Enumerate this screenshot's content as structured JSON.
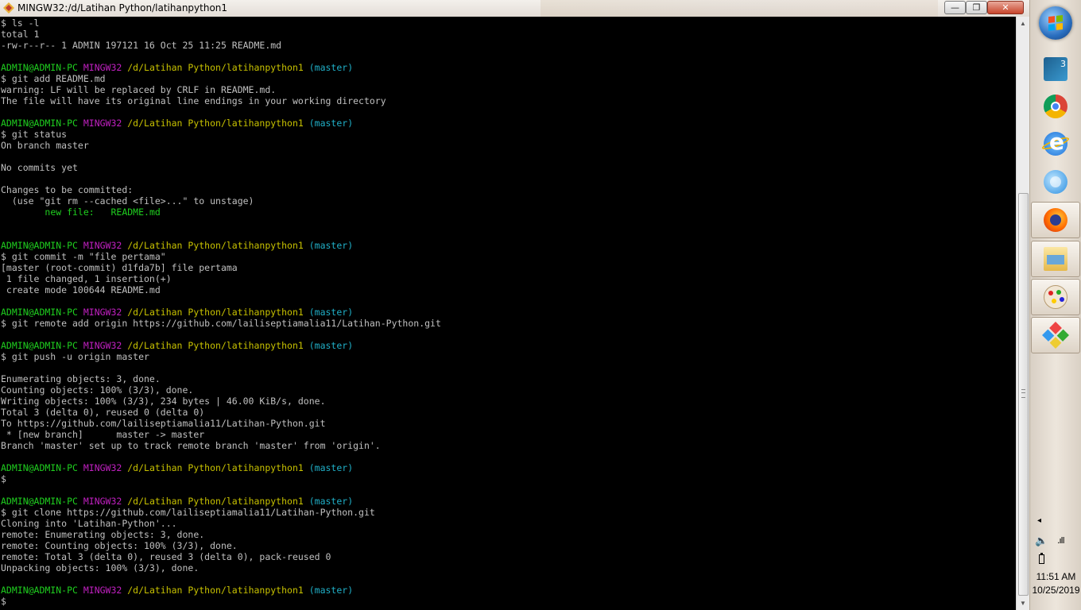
{
  "window": {
    "title": "MINGW32:/d/Latihan Python/latihanpython1",
    "minimize_label": "—",
    "maximize_label": "❐",
    "close_label": "✕"
  },
  "terminal": {
    "colors": {
      "text": "#c0c0c0",
      "user": "#1fcf1f",
      "mingw": "#c020c0",
      "path": "#c8c200",
      "branch": "#20b0c8"
    },
    "lines": [
      {
        "segs": [
          {
            "c": "",
            "t": "$ ls -l"
          }
        ]
      },
      {
        "segs": [
          {
            "c": "",
            "t": "total 1"
          }
        ]
      },
      {
        "segs": [
          {
            "c": "",
            "t": "-rw-r--r-- 1 ADMIN 197121 16 Oct 25 11:25 README.md"
          }
        ]
      },
      {
        "segs": [
          {
            "c": "",
            "t": ""
          }
        ]
      },
      {
        "segs": [
          {
            "c": "user",
            "t": "ADMIN@ADMIN-PC "
          },
          {
            "c": "mingw",
            "t": "MINGW32 "
          },
          {
            "c": "path",
            "t": "/d/Latihan Python/latihanpython1 "
          },
          {
            "c": "branch",
            "t": "(master)"
          }
        ]
      },
      {
        "segs": [
          {
            "c": "",
            "t": "$ git add README.md"
          }
        ]
      },
      {
        "segs": [
          {
            "c": "",
            "t": "warning: LF will be replaced by CRLF in README.md."
          }
        ]
      },
      {
        "segs": [
          {
            "c": "",
            "t": "The file will have its original line endings in your working directory"
          }
        ]
      },
      {
        "segs": [
          {
            "c": "",
            "t": ""
          }
        ]
      },
      {
        "segs": [
          {
            "c": "user",
            "t": "ADMIN@ADMIN-PC "
          },
          {
            "c": "mingw",
            "t": "MINGW32 "
          },
          {
            "c": "path",
            "t": "/d/Latihan Python/latihanpython1 "
          },
          {
            "c": "branch",
            "t": "(master)"
          }
        ]
      },
      {
        "segs": [
          {
            "c": "",
            "t": "$ git status"
          }
        ]
      },
      {
        "segs": [
          {
            "c": "",
            "t": "On branch master"
          }
        ]
      },
      {
        "segs": [
          {
            "c": "",
            "t": ""
          }
        ]
      },
      {
        "segs": [
          {
            "c": "",
            "t": "No commits yet"
          }
        ]
      },
      {
        "segs": [
          {
            "c": "",
            "t": ""
          }
        ]
      },
      {
        "segs": [
          {
            "c": "",
            "t": "Changes to be committed:"
          }
        ]
      },
      {
        "segs": [
          {
            "c": "",
            "t": "  (use \"git rm --cached <file>...\" to unstage)"
          }
        ]
      },
      {
        "segs": [
          {
            "c": "",
            "t": "        "
          },
          {
            "c": "green",
            "t": "new file:   README.md"
          }
        ]
      },
      {
        "segs": [
          {
            "c": "",
            "t": ""
          }
        ]
      },
      {
        "segs": [
          {
            "c": "",
            "t": ""
          }
        ]
      },
      {
        "segs": [
          {
            "c": "user",
            "t": "ADMIN@ADMIN-PC "
          },
          {
            "c": "mingw",
            "t": "MINGW32 "
          },
          {
            "c": "path",
            "t": "/d/Latihan Python/latihanpython1 "
          },
          {
            "c": "branch",
            "t": "(master)"
          }
        ]
      },
      {
        "segs": [
          {
            "c": "",
            "t": "$ git commit -m \"file pertama\""
          }
        ]
      },
      {
        "segs": [
          {
            "c": "",
            "t": "[master (root-commit) d1fda7b] file pertama"
          }
        ]
      },
      {
        "segs": [
          {
            "c": "",
            "t": " 1 file changed, 1 insertion(+)"
          }
        ]
      },
      {
        "segs": [
          {
            "c": "",
            "t": " create mode 100644 README.md"
          }
        ]
      },
      {
        "segs": [
          {
            "c": "",
            "t": ""
          }
        ]
      },
      {
        "segs": [
          {
            "c": "user",
            "t": "ADMIN@ADMIN-PC "
          },
          {
            "c": "mingw",
            "t": "MINGW32 "
          },
          {
            "c": "path",
            "t": "/d/Latihan Python/latihanpython1 "
          },
          {
            "c": "branch",
            "t": "(master)"
          }
        ]
      },
      {
        "segs": [
          {
            "c": "",
            "t": "$ git remote add origin https://github.com/lailiseptiamalia11/Latihan-Python.git"
          }
        ]
      },
      {
        "segs": [
          {
            "c": "",
            "t": ""
          }
        ]
      },
      {
        "segs": [
          {
            "c": "user",
            "t": "ADMIN@ADMIN-PC "
          },
          {
            "c": "mingw",
            "t": "MINGW32 "
          },
          {
            "c": "path",
            "t": "/d/Latihan Python/latihanpython1 "
          },
          {
            "c": "branch",
            "t": "(master)"
          }
        ]
      },
      {
        "segs": [
          {
            "c": "",
            "t": "$ git push -u origin master"
          }
        ]
      },
      {
        "segs": [
          {
            "c": "",
            "t": ""
          }
        ]
      },
      {
        "segs": [
          {
            "c": "",
            "t": "Enumerating objects: 3, done."
          }
        ]
      },
      {
        "segs": [
          {
            "c": "",
            "t": "Counting objects: 100% (3/3), done."
          }
        ]
      },
      {
        "segs": [
          {
            "c": "",
            "t": "Writing objects: 100% (3/3), 234 bytes | 46.00 KiB/s, done."
          }
        ]
      },
      {
        "segs": [
          {
            "c": "",
            "t": "Total 3 (delta 0), reused 0 (delta 0)"
          }
        ]
      },
      {
        "segs": [
          {
            "c": "",
            "t": "To https://github.com/lailiseptiamalia11/Latihan-Python.git"
          }
        ]
      },
      {
        "segs": [
          {
            "c": "",
            "t": " * [new branch]      master -> master"
          }
        ]
      },
      {
        "segs": [
          {
            "c": "",
            "t": "Branch 'master' set up to track remote branch 'master' from 'origin'."
          }
        ]
      },
      {
        "segs": [
          {
            "c": "",
            "t": ""
          }
        ]
      },
      {
        "segs": [
          {
            "c": "user",
            "t": "ADMIN@ADMIN-PC "
          },
          {
            "c": "mingw",
            "t": "MINGW32 "
          },
          {
            "c": "path",
            "t": "/d/Latihan Python/latihanpython1 "
          },
          {
            "c": "branch",
            "t": "(master)"
          }
        ]
      },
      {
        "segs": [
          {
            "c": "",
            "t": "$"
          }
        ]
      },
      {
        "segs": [
          {
            "c": "",
            "t": ""
          }
        ]
      },
      {
        "segs": [
          {
            "c": "user",
            "t": "ADMIN@ADMIN-PC "
          },
          {
            "c": "mingw",
            "t": "MINGW32 "
          },
          {
            "c": "path",
            "t": "/d/Latihan Python/latihanpython1 "
          },
          {
            "c": "branch",
            "t": "(master)"
          }
        ]
      },
      {
        "segs": [
          {
            "c": "",
            "t": "$ git clone https://github.com/lailiseptiamalia11/Latihan-Python.git"
          }
        ]
      },
      {
        "segs": [
          {
            "c": "",
            "t": "Cloning into 'Latihan-Python'..."
          }
        ]
      },
      {
        "segs": [
          {
            "c": "",
            "t": "remote: Enumerating objects: 3, done."
          }
        ]
      },
      {
        "segs": [
          {
            "c": "",
            "t": "remote: Counting objects: 100% (3/3), done."
          }
        ]
      },
      {
        "segs": [
          {
            "c": "",
            "t": "remote: Total 3 (delta 0), reused 3 (delta 0), pack-reused 0"
          }
        ]
      },
      {
        "segs": [
          {
            "c": "",
            "t": "Unpacking objects: 100% (3/3), done."
          }
        ]
      },
      {
        "segs": [
          {
            "c": "",
            "t": ""
          }
        ]
      },
      {
        "segs": [
          {
            "c": "user",
            "t": "ADMIN@ADMIN-PC "
          },
          {
            "c": "mingw",
            "t": "MINGW32 "
          },
          {
            "c": "path",
            "t": "/d/Latihan Python/latihanpython1 "
          },
          {
            "c": "branch",
            "t": "(master)"
          }
        ]
      },
      {
        "segs": [
          {
            "c": "",
            "t": "$"
          }
        ]
      }
    ]
  },
  "scrollbar": {
    "up_glyph": "▲",
    "down_glyph": "▼"
  },
  "taskbar": {
    "items": [
      {
        "icon": "game-icon",
        "name": "taskbar-item-game"
      },
      {
        "icon": "chrome-icon",
        "name": "taskbar-item-chrome"
      },
      {
        "icon": "internet-explorer-icon",
        "name": "taskbar-item-internet-explorer"
      },
      {
        "icon": "thunderbird-icon",
        "name": "taskbar-item-thunderbird"
      },
      {
        "icon": "firefox-icon",
        "name": "taskbar-item-firefox"
      },
      {
        "icon": "file-explorer-icon",
        "name": "taskbar-item-file-explorer"
      },
      {
        "icon": "paint-icon",
        "name": "taskbar-item-paint"
      },
      {
        "icon": "git-icon",
        "name": "taskbar-item-git"
      }
    ],
    "tray": {
      "arrow": "◂",
      "volume_glyph": "🔈",
      "network_glyph": ".ıll",
      "time": "11:51 AM",
      "date": "10/25/2019"
    }
  }
}
